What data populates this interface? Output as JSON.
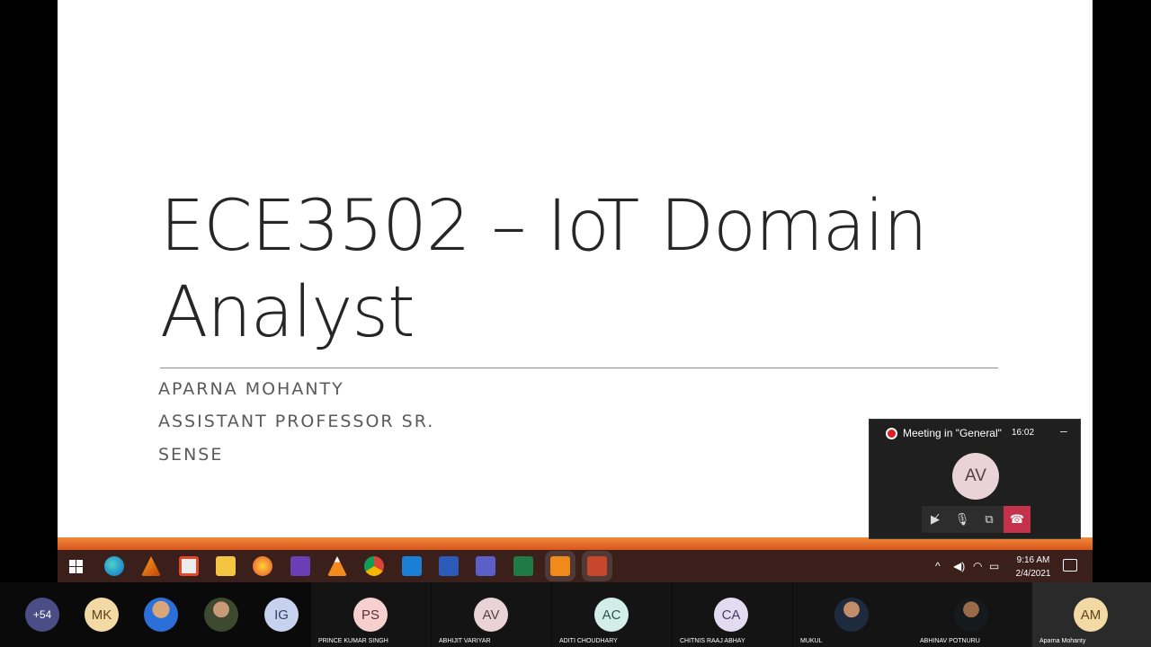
{
  "slide": {
    "title_line1": "ECE3502 – IoT Domain",
    "title_line2": "Analyst",
    "subtitle_lines": [
      "APARNA MOHANTY",
      "ASSISTANT PROFESSOR SR.",
      "SENSE"
    ]
  },
  "taskbar": {
    "icons": [
      "windows-start-icon",
      "edge-icon",
      "matlab-icon",
      "store-icon",
      "file-explorer-icon",
      "firefox-icon",
      "visual-studio-icon",
      "vlc-icon",
      "chrome-icon",
      "mail-icon",
      "word-icon",
      "teams-icon",
      "excel-icon",
      "snagit-icon",
      "powerpoint-icon"
    ],
    "clock_time": "9:16 AM",
    "clock_date": "2/4/2021",
    "accent": "#d9561c"
  },
  "meeting": {
    "title": "Meeting in \"General\"",
    "elapsed": "16:02",
    "minimize_glyph": "–",
    "presenter_initials": "AV"
  },
  "participants": [
    {
      "initials": "+54",
      "name": ""
    },
    {
      "initials": "MK",
      "name": ""
    },
    {
      "initials": "",
      "name": ""
    },
    {
      "initials": "",
      "name": ""
    },
    {
      "initials": "IG",
      "name": ""
    },
    {
      "initials": "PS",
      "name": "PRINCE KUMAR SINGH"
    },
    {
      "initials": "AV",
      "name": "ABHIJIT VARIYAR"
    },
    {
      "initials": "AC",
      "name": "ADITI CHOUDHARY"
    },
    {
      "initials": "CA",
      "name": "CHITNIS RAAJ ABHAY"
    },
    {
      "initials": "",
      "name": "MUKUL"
    },
    {
      "initials": "",
      "name": "ABHINAV POTNURU"
    },
    {
      "initials": "AM",
      "name": "Aparna Mohanty"
    }
  ]
}
